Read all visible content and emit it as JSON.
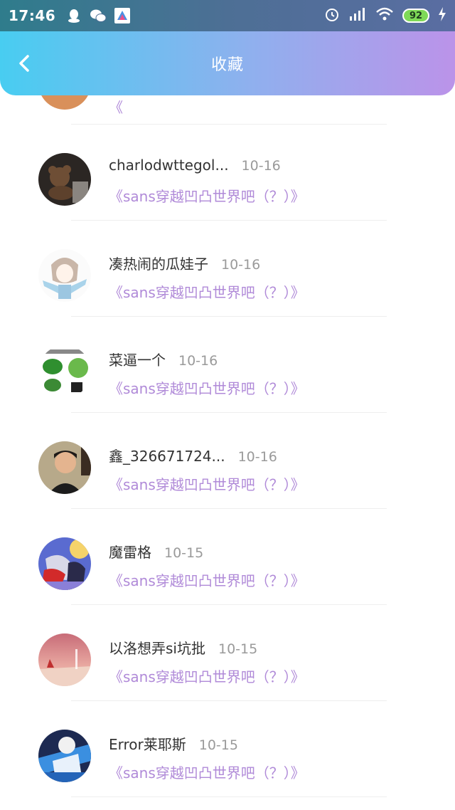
{
  "status_bar": {
    "time": "17:46",
    "battery": "92"
  },
  "header": {
    "title": "收藏"
  },
  "items": [
    {
      "name": "",
      "date": "",
      "post": "《"
    },
    {
      "name": "charlodwttegol...",
      "date": "10-16",
      "post": "《sans穿越凹凸世界吧（？）》"
    },
    {
      "name": "凑热闹的瓜娃子",
      "date": "10-16",
      "post": "《sans穿越凹凸世界吧（？）》"
    },
    {
      "name": "菜逼一个",
      "date": "10-16",
      "post": "《sans穿越凹凸世界吧（？）》"
    },
    {
      "name": "鑫_326671724...",
      "date": "10-16",
      "post": "《sans穿越凹凸世界吧（？）》"
    },
    {
      "name": "魔雷格",
      "date": "10-15",
      "post": "《sans穿越凹凸世界吧（？）》"
    },
    {
      "name": "以洛想弄si坑批",
      "date": "10-15",
      "post": "《sans穿越凹凸世界吧（？）》"
    },
    {
      "name": "Error莱耶斯",
      "date": "10-15",
      "post": "《sans穿越凹凸世界吧（？）》"
    }
  ],
  "colors": {
    "header_start": "#48cdf1",
    "header_end": "#bb93e9",
    "post_link": "#b08ad8"
  },
  "icons": {
    "back": "chevron-left-icon",
    "status": [
      "qq-icon",
      "wechat-icon",
      "app-icon",
      "alarm-icon",
      "signal-icon",
      "wifi-icon",
      "battery-icon",
      "charging-icon"
    ]
  }
}
